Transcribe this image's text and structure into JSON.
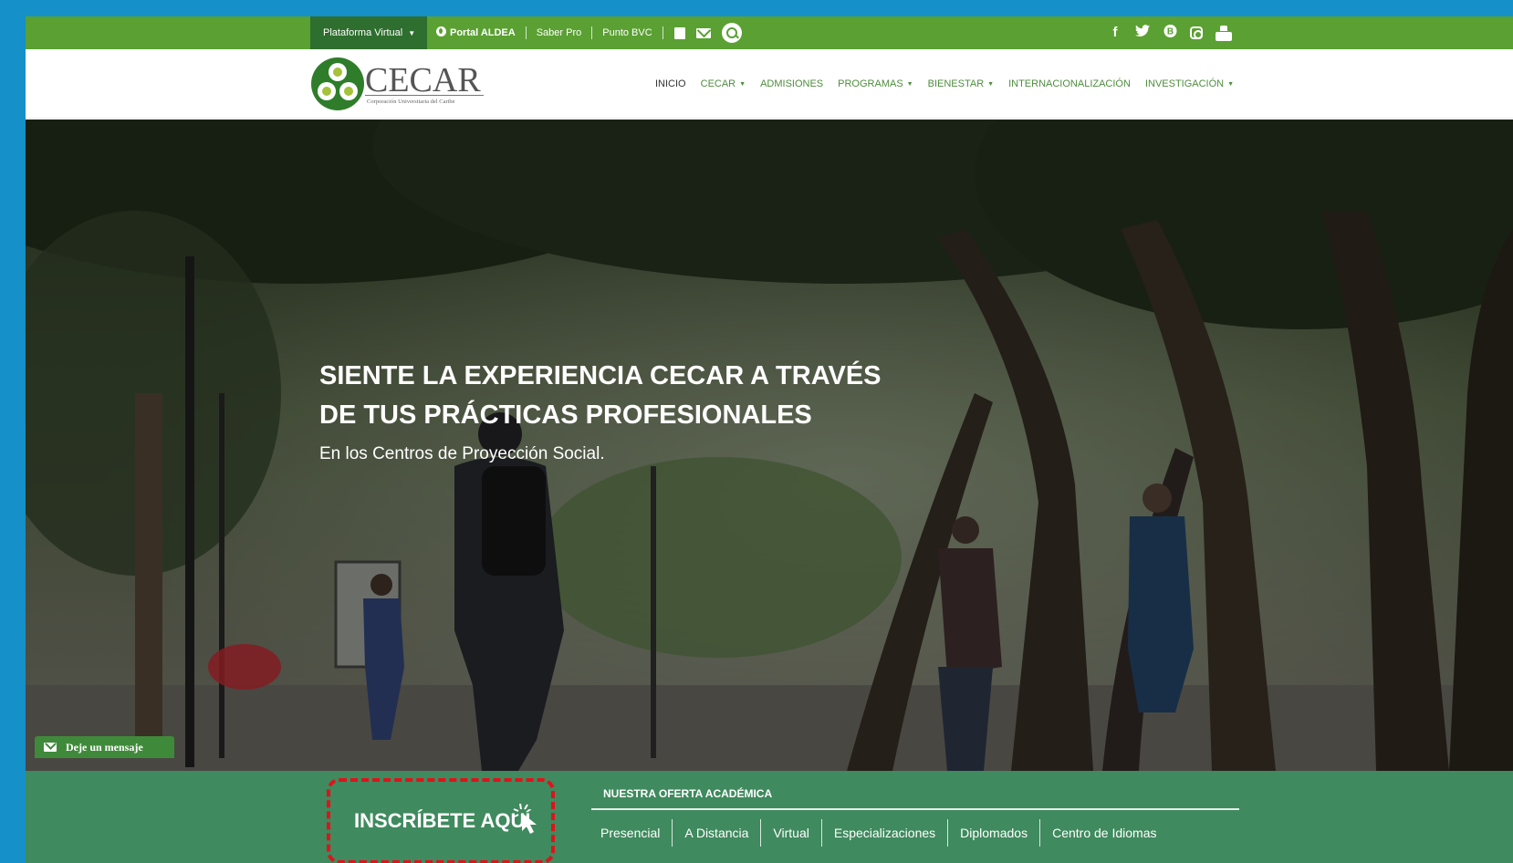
{
  "topbar": {
    "platform_label": "Plataforma Virtual",
    "links": [
      "Portal ALDEA",
      "Saber Pro",
      "Punto BVC"
    ],
    "icons": [
      "book-icon",
      "mail-icon",
      "search-icon"
    ],
    "social": [
      "facebook-icon",
      "twitter-icon",
      "behance-icon",
      "instagram-icon",
      "youtube-icon"
    ]
  },
  "logo": {
    "wordmark": "CECAR",
    "subtitle": "Corporación Universitaria del Caribe"
  },
  "nav": {
    "items": [
      {
        "label": "INICIO",
        "dropdown": false
      },
      {
        "label": "CECAR",
        "dropdown": true
      },
      {
        "label": "ADMISIONES",
        "dropdown": false
      },
      {
        "label": "PROGRAMAS",
        "dropdown": true
      },
      {
        "label": "BIENESTAR",
        "dropdown": true
      },
      {
        "label": "INTERNACIONALIZACIÓN",
        "dropdown": false
      },
      {
        "label": "INVESTIGACIÓN",
        "dropdown": true
      }
    ]
  },
  "hero": {
    "title_line1": "SIENTE LA EXPERIENCIA CECAR A TRAVÉS",
    "title_line2": "DE TUS PRÁCTICAS PROFESIONALES",
    "subtitle": "En los Centros de Proyección Social."
  },
  "message_tab": {
    "label": "Deje un mensaje"
  },
  "enroll": {
    "label": "INSCRÍBETE AQUÍ"
  },
  "academic": {
    "title": "NUESTRA OFERTA ACADÉMICA",
    "tabs": [
      "Presencial",
      "A Distancia",
      "Virtual",
      "Especializaciones",
      "Diplomados",
      "Centro de Idiomas"
    ]
  },
  "colors": {
    "page_border": "#1590c8",
    "topbar_green": "#5aa032",
    "platform_dark": "#2e6e2e",
    "nav_green": "#4d8d3c",
    "bottombar_green": "#3f8a5e",
    "highlight_red": "#e0121b"
  }
}
